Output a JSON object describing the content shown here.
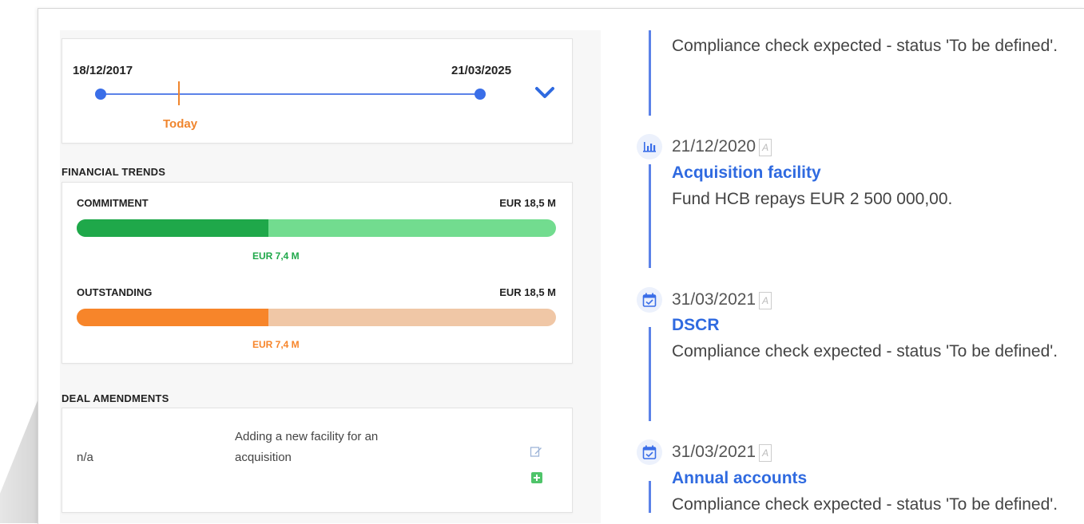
{
  "date_range": {
    "start": "18/12/2017",
    "end": "21/03/2025",
    "today_label": "Today"
  },
  "financial_trends": {
    "title": "FINANCIAL TRENDS",
    "commitment": {
      "label": "COMMITMENT",
      "total": "EUR 18,5 M",
      "current": "EUR 7,4 M",
      "fraction": 0.4,
      "color_dark": "#1fa84a",
      "color_light": "#72dc8f"
    },
    "outstanding": {
      "label": "OUTSTANDING",
      "total": "EUR 18,5 M",
      "current": "EUR 7,4 M",
      "fraction": 0.4,
      "color_dark": "#f7852a",
      "color_light": "#f0c7a6"
    }
  },
  "deal_amendments": {
    "title": "DEAL AMENDMENTS",
    "rows": [
      {
        "ref": "n/a",
        "description_line1": "Adding a new facility for an",
        "description_line2": "acquisition"
      }
    ]
  },
  "timeline": {
    "top_description": "Compliance check expected - status 'To be defined'.",
    "events": [
      {
        "icon": "bar-chart-icon",
        "date": "21/12/2020",
        "badge": "A",
        "title": "Acquisition facility",
        "description": "Fund HCB repays EUR 2 500 000,00."
      },
      {
        "icon": "calendar-check-icon",
        "date": "31/03/2021",
        "badge": "A",
        "title": "DSCR",
        "description": "Compliance check expected - status 'To be defined'."
      },
      {
        "icon": "calendar-check-icon",
        "date": "31/03/2021",
        "badge": "A",
        "title": "Annual accounts",
        "description": "Compliance check expected - status 'To be defined'."
      }
    ]
  }
}
